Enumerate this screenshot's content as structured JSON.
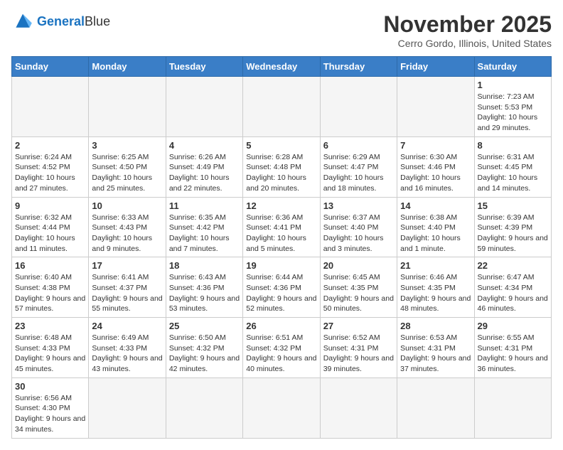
{
  "header": {
    "logo_general": "General",
    "logo_blue": "Blue",
    "month": "November 2025",
    "location": "Cerro Gordo, Illinois, United States"
  },
  "days_of_week": [
    "Sunday",
    "Monday",
    "Tuesday",
    "Wednesday",
    "Thursday",
    "Friday",
    "Saturday"
  ],
  "weeks": [
    [
      {
        "day": "",
        "info": ""
      },
      {
        "day": "",
        "info": ""
      },
      {
        "day": "",
        "info": ""
      },
      {
        "day": "",
        "info": ""
      },
      {
        "day": "",
        "info": ""
      },
      {
        "day": "",
        "info": ""
      },
      {
        "day": "1",
        "info": "Sunrise: 7:23 AM\nSunset: 5:53 PM\nDaylight: 10 hours and 29 minutes."
      }
    ],
    [
      {
        "day": "2",
        "info": "Sunrise: 6:24 AM\nSunset: 4:52 PM\nDaylight: 10 hours and 27 minutes."
      },
      {
        "day": "3",
        "info": "Sunrise: 6:25 AM\nSunset: 4:50 PM\nDaylight: 10 hours and 25 minutes."
      },
      {
        "day": "4",
        "info": "Sunrise: 6:26 AM\nSunset: 4:49 PM\nDaylight: 10 hours and 22 minutes."
      },
      {
        "day": "5",
        "info": "Sunrise: 6:28 AM\nSunset: 4:48 PM\nDaylight: 10 hours and 20 minutes."
      },
      {
        "day": "6",
        "info": "Sunrise: 6:29 AM\nSunset: 4:47 PM\nDaylight: 10 hours and 18 minutes."
      },
      {
        "day": "7",
        "info": "Sunrise: 6:30 AM\nSunset: 4:46 PM\nDaylight: 10 hours and 16 minutes."
      },
      {
        "day": "8",
        "info": "Sunrise: 6:31 AM\nSunset: 4:45 PM\nDaylight: 10 hours and 14 minutes."
      }
    ],
    [
      {
        "day": "9",
        "info": "Sunrise: 6:32 AM\nSunset: 4:44 PM\nDaylight: 10 hours and 11 minutes."
      },
      {
        "day": "10",
        "info": "Sunrise: 6:33 AM\nSunset: 4:43 PM\nDaylight: 10 hours and 9 minutes."
      },
      {
        "day": "11",
        "info": "Sunrise: 6:35 AM\nSunset: 4:42 PM\nDaylight: 10 hours and 7 minutes."
      },
      {
        "day": "12",
        "info": "Sunrise: 6:36 AM\nSunset: 4:41 PM\nDaylight: 10 hours and 5 minutes."
      },
      {
        "day": "13",
        "info": "Sunrise: 6:37 AM\nSunset: 4:40 PM\nDaylight: 10 hours and 3 minutes."
      },
      {
        "day": "14",
        "info": "Sunrise: 6:38 AM\nSunset: 4:40 PM\nDaylight: 10 hours and 1 minute."
      },
      {
        "day": "15",
        "info": "Sunrise: 6:39 AM\nSunset: 4:39 PM\nDaylight: 9 hours and 59 minutes."
      }
    ],
    [
      {
        "day": "16",
        "info": "Sunrise: 6:40 AM\nSunset: 4:38 PM\nDaylight: 9 hours and 57 minutes."
      },
      {
        "day": "17",
        "info": "Sunrise: 6:41 AM\nSunset: 4:37 PM\nDaylight: 9 hours and 55 minutes."
      },
      {
        "day": "18",
        "info": "Sunrise: 6:43 AM\nSunset: 4:36 PM\nDaylight: 9 hours and 53 minutes."
      },
      {
        "day": "19",
        "info": "Sunrise: 6:44 AM\nSunset: 4:36 PM\nDaylight: 9 hours and 52 minutes."
      },
      {
        "day": "20",
        "info": "Sunrise: 6:45 AM\nSunset: 4:35 PM\nDaylight: 9 hours and 50 minutes."
      },
      {
        "day": "21",
        "info": "Sunrise: 6:46 AM\nSunset: 4:35 PM\nDaylight: 9 hours and 48 minutes."
      },
      {
        "day": "22",
        "info": "Sunrise: 6:47 AM\nSunset: 4:34 PM\nDaylight: 9 hours and 46 minutes."
      }
    ],
    [
      {
        "day": "23",
        "info": "Sunrise: 6:48 AM\nSunset: 4:33 PM\nDaylight: 9 hours and 45 minutes."
      },
      {
        "day": "24",
        "info": "Sunrise: 6:49 AM\nSunset: 4:33 PM\nDaylight: 9 hours and 43 minutes."
      },
      {
        "day": "25",
        "info": "Sunrise: 6:50 AM\nSunset: 4:32 PM\nDaylight: 9 hours and 42 minutes."
      },
      {
        "day": "26",
        "info": "Sunrise: 6:51 AM\nSunset: 4:32 PM\nDaylight: 9 hours and 40 minutes."
      },
      {
        "day": "27",
        "info": "Sunrise: 6:52 AM\nSunset: 4:31 PM\nDaylight: 9 hours and 39 minutes."
      },
      {
        "day": "28",
        "info": "Sunrise: 6:53 AM\nSunset: 4:31 PM\nDaylight: 9 hours and 37 minutes."
      },
      {
        "day": "29",
        "info": "Sunrise: 6:55 AM\nSunset: 4:31 PM\nDaylight: 9 hours and 36 minutes."
      }
    ],
    [
      {
        "day": "30",
        "info": "Sunrise: 6:56 AM\nSunset: 4:30 PM\nDaylight: 9 hours and 34 minutes."
      },
      {
        "day": "",
        "info": ""
      },
      {
        "day": "",
        "info": ""
      },
      {
        "day": "",
        "info": ""
      },
      {
        "day": "",
        "info": ""
      },
      {
        "day": "",
        "info": ""
      },
      {
        "day": "",
        "info": ""
      }
    ]
  ]
}
